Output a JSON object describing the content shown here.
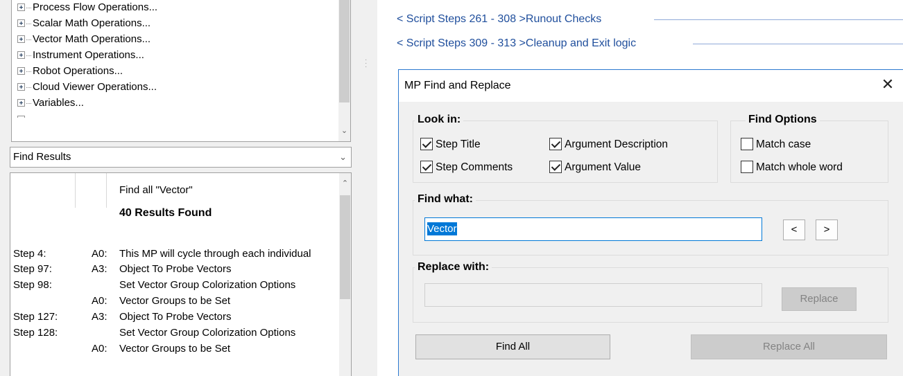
{
  "toolbox": {
    "items": [
      {
        "label": "Process Flow Operations..."
      },
      {
        "label": "Scalar Math Operations..."
      },
      {
        "label": "Vector Math Operations..."
      },
      {
        "label": "Instrument Operations..."
      },
      {
        "label": "Robot Operations..."
      },
      {
        "label": "Cloud Viewer Operations..."
      },
      {
        "label": "Variables..."
      }
    ]
  },
  "find_results": {
    "header": "Find Results",
    "query_line": "Find all  \"Vector\"",
    "count_line": "40 Results Found",
    "rows": [
      {
        "step": "Step 4:",
        "arg": "A0:",
        "text": "This MP will cycle through each individual"
      },
      {
        "step": "Step 97:",
        "arg": "A3:",
        "text": "Object To Probe Vectors"
      },
      {
        "step": "Step 98:",
        "arg": "",
        "text": "Set Vector Group Colorization Options"
      },
      {
        "step": "",
        "arg": "A0:",
        "text": "Vector Groups to be Set"
      },
      {
        "step": "Step 127:",
        "arg": "A3:",
        "text": "Object To Probe Vectors"
      },
      {
        "step": "Step 128:",
        "arg": "",
        "text": "Set Vector Group Colorization Options"
      },
      {
        "step": "",
        "arg": "A0:",
        "text": "Vector Groups to be Set"
      }
    ]
  },
  "script_sections": [
    {
      "label": "< Script Steps 261 - 308 >Runout Checks"
    },
    {
      "label": "< Script Steps 309 - 313 >Cleanup and Exit logic"
    }
  ],
  "dialog": {
    "title": "MP Find and Replace",
    "close_glyph": "✕",
    "look_in": {
      "label": "Look in:",
      "step_title": "Step Title",
      "step_comments": "Step Comments",
      "argument_description": "Argument Description",
      "argument_value": "Argument Value"
    },
    "find_options": {
      "label": "Find Options",
      "match_case": "Match case",
      "match_whole_word": "Match whole word"
    },
    "find_what": {
      "label": "Find what:",
      "value": "Vector"
    },
    "prev_label": "<",
    "next_label": ">",
    "replace_with": {
      "label": "Replace with:",
      "value": ""
    },
    "replace_label": "Replace",
    "find_all_label": "Find All",
    "replace_all_label": "Replace All",
    "checked": {
      "step_title": true,
      "step_comments": true,
      "argument_description": true,
      "argument_value": true,
      "match_case": false,
      "match_whole_word": false
    }
  }
}
